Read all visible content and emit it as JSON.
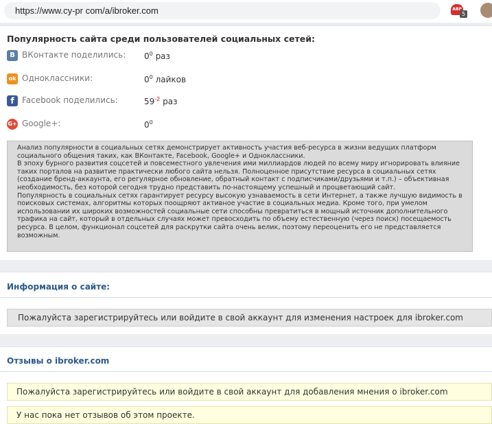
{
  "browser": {
    "url": "https://www.cy-pr com/a/ibroker.com",
    "extension_label": "ABP",
    "extension_badge": "5"
  },
  "social": {
    "title": "Популярность сайта среди пользователей социальных сетей:",
    "rows": [
      {
        "icon": "vk-icon",
        "glyph": "B",
        "color": "#5b7fa6",
        "label": "ВКонтакте поделились:",
        "value": "0",
        "sup": "0",
        "unit": "раз"
      },
      {
        "icon": "odnoklassniki-icon",
        "glyph": "ok",
        "color": "#f0901e",
        "label": "Одноклассники:",
        "value": "0",
        "sup": "0",
        "unit": "лайков"
      },
      {
        "icon": "facebook-icon",
        "glyph": "f",
        "color": "#3b5998",
        "label": "Facebook поделились:",
        "value": "59",
        "sup": "-2",
        "unit": "раз"
      },
      {
        "icon": "googleplus-icon",
        "glyph": "G+",
        "color": "#dd4b39",
        "label": "Google+:",
        "value": "0",
        "sup": "0",
        "unit": ""
      }
    ],
    "description": [
      "Анализ популярности в социальных сетях демонстрирует активность участия веб-ресурса в жизни ведущих платформ социального общения таких, как ВКонтакте, Facebook, Google+ и Одноклассники.",
      "В эпоху бурного развития соцсетей и повсеместного увлечения ими миллиардов людей по всему миру игнорировать влияние таких порталов на развитие практически любого сайта нельзя. Полноценное присутствие ресурса в социальных сетях (создание бренд-аккаунта, его регулярное обновление, обратный контакт с подписчиками/друзьями и т.п.) – объективная необходимость, без которой сегодня трудно представить по-настоящему успешный и процветающий сайт.",
      "Популярность в социальных сетях гарантирует ресурсу высокую узнаваемость в сети Интернет, а также лучшую видимость в поисковых системах, алгоритмы которых поощряют активное участие в социальных медиа. Кроме того, при умелом использовании их широких возможностей социальные сети способны превратиться в мощный источник дополнительного трафика на сайт, который в отдельных случаях может превосходить по объему естественную (через поиск) посещаемость ресурса. В целом, функционал соцсетей для раскрутки сайта очень велик, поэтому переоценить его не представляется возможным."
    ]
  },
  "site_info": {
    "title": "Информация о сайте:",
    "notice": "Пожалуйста зарегистрируйтесь или войдите в свой аккаунт для изменения настроек для ibroker.com"
  },
  "reviews": {
    "title": "Отзывы о ibroker.com",
    "login_notice": "Пожалуйста зарегистрируйтесь или войдите в свой аккаунт для добавления мнения о ibroker.com",
    "empty_notice": "У нас пока нет отзывов об этом проекте."
  }
}
